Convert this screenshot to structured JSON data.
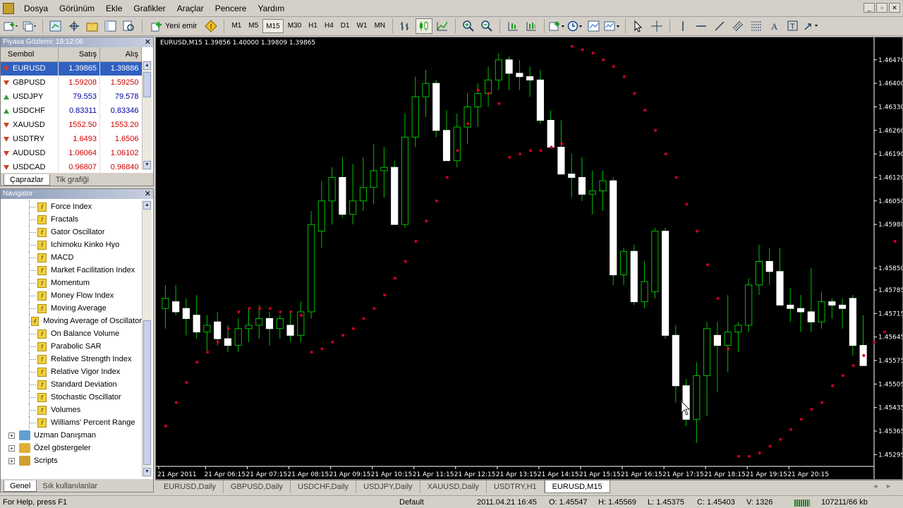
{
  "menu": [
    "Dosya",
    "Görünüm",
    "Ekle",
    "Grafikler",
    "Araçlar",
    "Pencere",
    "Yardım"
  ],
  "toolbar": {
    "new_order": "Yeni emir",
    "timeframes": [
      "M1",
      "M5",
      "M15",
      "M30",
      "H1",
      "H4",
      "D1",
      "W1",
      "MN"
    ],
    "active_timeframe": "M15"
  },
  "market_watch": {
    "title": "Piyasa Gözlemi: 18:12:06",
    "headers": {
      "symbol": "Sembol",
      "bid": "Satış",
      "ask": "Alış"
    },
    "rows": [
      {
        "symbol": "EURUSD",
        "bid": "1.39865",
        "ask": "1.39886",
        "dir": "down",
        "color": "blue",
        "selected": true
      },
      {
        "symbol": "GBPUSD",
        "bid": "1.59208",
        "ask": "1.59250",
        "dir": "down",
        "color": "red"
      },
      {
        "symbol": "USDJPY",
        "bid": "79.553",
        "ask": "79.578",
        "dir": "up",
        "color": "blue"
      },
      {
        "symbol": "USDCHF",
        "bid": "0.83311",
        "ask": "0.83346",
        "dir": "up",
        "color": "blue"
      },
      {
        "symbol": "XAUUSD",
        "bid": "1552.50",
        "ask": "1553.20",
        "dir": "down",
        "color": "red"
      },
      {
        "symbol": "USDTRY",
        "bid": "1.6493",
        "ask": "1.6506",
        "dir": "down",
        "color": "red"
      },
      {
        "symbol": "AUDUSD",
        "bid": "1.06064",
        "ask": "1.06102",
        "dir": "down",
        "color": "red"
      },
      {
        "symbol": "USDCAD",
        "bid": "0.96807",
        "ask": "0.96840",
        "dir": "down",
        "color": "red"
      }
    ],
    "tabs": [
      "Çaprazlar",
      "Tik grafiği"
    ]
  },
  "navigator": {
    "title": "Navigator",
    "indicators": [
      "Force Index",
      "Fractals",
      "Gator Oscillator",
      "Ichimoku Kinko Hyo",
      "MACD",
      "Market Facilitation Index",
      "Momentum",
      "Money Flow Index",
      "Moving Average",
      "Moving Average of Oscillator",
      "On Balance Volume",
      "Parabolic SAR",
      "Relative Strength Index",
      "Relative Vigor Index",
      "Standard Deviation",
      "Stochastic Oscillator",
      "Volumes",
      "Williams' Percent Range"
    ],
    "folders": [
      {
        "label": "Uzman Danışman",
        "icon": "expert-advisor-icon"
      },
      {
        "label": "Özel göstergeler",
        "icon": "custom-indicators-icon"
      },
      {
        "label": "Scripts",
        "icon": "scripts-icon"
      }
    ],
    "tabs": [
      "Genel",
      "Sık kullanılanlar"
    ]
  },
  "chart": {
    "header": "EURUSD,M15  1.39856 1.40000 1.39809 1.39865",
    "bull_color": "#00c000",
    "bear_color": "#ffffff",
    "sar_color": "#d00020"
  },
  "chart_data": {
    "type": "candlestick",
    "symbol": "EURUSD",
    "timeframe": "M15",
    "ylim": [
      1.4526,
      1.4652
    ],
    "y_ticks": [
      "1.46470",
      "1.46400",
      "1.46330",
      "1.46260",
      "1.46190",
      "1.46120",
      "1.46050",
      "1.45980",
      "1.45850",
      "1.45785",
      "1.45715",
      "1.45645",
      "1.45575",
      "1.45505",
      "1.45435",
      "1.45365",
      "1.45295"
    ],
    "x_ticks": [
      "21 Apr 2011",
      "21 Apr 06:15",
      "21 Apr 07:15",
      "21 Apr 08:15",
      "21 Apr 09:15",
      "21 Apr 10:15",
      "21 Apr 11:15",
      "21 Apr 12:15",
      "21 Apr 13:15",
      "21 Apr 14:15",
      "21 Apr 15:15",
      "21 Apr 16:15",
      "21 Apr 17:15",
      "21 Apr 18:15",
      "21 Apr 19:15",
      "21 Apr 20:15"
    ],
    "candles": [
      [
        1.4573,
        1.458,
        1.4567,
        1.4576
      ],
      [
        1.4575,
        1.458,
        1.4571,
        1.4572
      ],
      [
        1.4573,
        1.4576,
        1.4565,
        1.457
      ],
      [
        1.4571,
        1.4577,
        1.4564,
        1.4566
      ],
      [
        1.4566,
        1.4571,
        1.456,
        1.4568
      ],
      [
        1.4569,
        1.4572,
        1.4562,
        1.4564
      ],
      [
        1.4564,
        1.4568,
        1.456,
        1.4562
      ],
      [
        1.4562,
        1.457,
        1.456,
        1.4567
      ],
      [
        1.4567,
        1.4573,
        1.4563,
        1.4568
      ],
      [
        1.4568,
        1.4574,
        1.4564,
        1.457
      ],
      [
        1.457,
        1.4572,
        1.4562,
        1.4567
      ],
      [
        1.4567,
        1.4571,
        1.4564,
        1.457
      ],
      [
        1.4568,
        1.4572,
        1.4563,
        1.4565
      ],
      [
        1.4565,
        1.4575,
        1.4563,
        1.4572
      ],
      [
        1.4572,
        1.4602,
        1.457,
        1.4598
      ],
      [
        1.4596,
        1.4611,
        1.4591,
        1.4605
      ],
      [
        1.4605,
        1.4615,
        1.4598,
        1.4612
      ],
      [
        1.4612,
        1.4618,
        1.46,
        1.4601
      ],
      [
        1.4601,
        1.4616,
        1.4598,
        1.4605
      ],
      [
        1.4605,
        1.4618,
        1.4602,
        1.4609
      ],
      [
        1.4609,
        1.4622,
        1.4604,
        1.4614
      ],
      [
        1.4614,
        1.4621,
        1.4606,
        1.4615
      ],
      [
        1.4615,
        1.4617,
        1.46,
        1.4598
      ],
      [
        1.4598,
        1.4631,
        1.4597,
        1.4624
      ],
      [
        1.4624,
        1.4642,
        1.4621,
        1.4636
      ],
      [
        1.4636,
        1.4644,
        1.463,
        1.464
      ],
      [
        1.464,
        1.4641,
        1.4624,
        1.4626
      ],
      [
        1.4626,
        1.4632,
        1.4617,
        1.4617
      ],
      [
        1.4617,
        1.4631,
        1.4615,
        1.4627
      ],
      [
        1.4627,
        1.4637,
        1.4622,
        1.4633
      ],
      [
        1.4633,
        1.464,
        1.4627,
        1.4637
      ],
      [
        1.4637,
        1.4645,
        1.4633,
        1.4641
      ],
      [
        1.4641,
        1.4649,
        1.4638,
        1.4647
      ],
      [
        1.4647,
        1.4648,
        1.4638,
        1.4643
      ],
      [
        1.4643,
        1.4647,
        1.4638,
        1.4642
      ],
      [
        1.4642,
        1.4645,
        1.4636,
        1.4641
      ],
      [
        1.4641,
        1.4644,
        1.4628,
        1.4629
      ],
      [
        1.4629,
        1.4632,
        1.4621,
        1.4621
      ],
      [
        1.4621,
        1.4629,
        1.4613,
        1.4613
      ],
      [
        1.4613,
        1.4619,
        1.4606,
        1.4612
      ],
      [
        1.4612,
        1.4618,
        1.4605,
        1.4607
      ],
      [
        1.4607,
        1.4614,
        1.4601,
        1.4608
      ],
      [
        1.4608,
        1.4614,
        1.4602,
        1.4611
      ],
      [
        1.4611,
        1.4612,
        1.458,
        1.4583
      ],
      [
        1.4583,
        1.4591,
        1.458,
        1.459
      ],
      [
        1.459,
        1.4592,
        1.4574,
        1.4575
      ],
      [
        1.4575,
        1.4587,
        1.4573,
        1.4581
      ],
      [
        1.4578,
        1.4597,
        1.4576,
        1.4596
      ],
      [
        1.4596,
        1.4597,
        1.4564,
        1.4565
      ],
      [
        1.4565,
        1.4568,
        1.4545,
        1.455
      ],
      [
        1.455,
        1.4552,
        1.4538,
        1.454
      ],
      [
        1.454,
        1.4557,
        1.4533,
        1.4553
      ],
      [
        1.4553,
        1.4569,
        1.4541,
        1.4567
      ],
      [
        1.4565,
        1.4569,
        1.4548,
        1.4562
      ],
      [
        1.4562,
        1.4577,
        1.4554,
        1.4566
      ],
      [
        1.4566,
        1.4569,
        1.456,
        1.4568
      ],
      [
        1.4568,
        1.4582,
        1.4566,
        1.458
      ],
      [
        1.458,
        1.4592,
        1.4577,
        1.4587
      ],
      [
        1.4587,
        1.4591,
        1.458,
        1.4584
      ],
      [
        1.4584,
        1.4591,
        1.4574,
        1.4574
      ],
      [
        1.4574,
        1.4579,
        1.4569,
        1.4573
      ],
      [
        1.4573,
        1.4577,
        1.4566,
        1.4572
      ],
      [
        1.4572,
        1.4585,
        1.4566,
        1.4569
      ],
      [
        1.4569,
        1.4578,
        1.4567,
        1.4575
      ],
      [
        1.4575,
        1.4576,
        1.457,
        1.4574
      ],
      [
        1.4574,
        1.4576,
        1.4567,
        1.4573
      ],
      [
        1.4576,
        1.4577,
        1.4559,
        1.4562
      ],
      [
        1.4562,
        1.4571,
        1.4556,
        1.4556
      ]
    ],
    "sar": [
      1.4538,
      1.4545,
      1.4551,
      1.4557,
      1.456,
      1.4563,
      1.4567,
      1.4572,
      1.4573,
      1.4573,
      1.4573,
      1.4572,
      1.4572,
      1.4571,
      1.456,
      1.4561,
      1.4563,
      1.4565,
      1.4567,
      1.457,
      1.4573,
      1.4577,
      1.4582,
      1.4587,
      1.4593,
      1.4599,
      1.4605,
      1.4612,
      1.462,
      1.4628,
      1.4638,
      1.4637,
      1.4634,
      1.4618,
      1.4619,
      1.462,
      1.462,
      1.4621,
      1.4622,
      1.4651,
      1.465,
      1.4649,
      1.4647,
      1.4645,
      1.4642,
      1.4637,
      1.4632,
      1.4626,
      1.4619,
      1.4612,
      1.4604,
      1.4596,
      1.4586,
      1.4576,
      1.4561,
      1.4529,
      1.4529,
      1.453,
      1.4532,
      1.4534,
      1.4537,
      1.454,
      1.4543,
      1.4545,
      1.455,
      1.4553,
      1.4556,
      1.4559,
      1.4563,
      1.4566,
      1.4593,
      1.4592
    ]
  },
  "chart_tabs": [
    "EURUSD,Daily",
    "GBPUSD,Daily",
    "USDCHF,Daily",
    "USDJPY,Daily",
    "XAUUSD,Daily",
    "USDTRY,H1",
    "EURUSD,M15"
  ],
  "active_chart_tab": "EURUSD,M15",
  "status": {
    "help": "For Help, press F1",
    "profile": "Default",
    "datetime": "2011.04.21 16:45",
    "open": "O: 1.45547",
    "high": "H: 1.45569",
    "low": "L: 1.45375",
    "close": "C: 1.45403",
    "volume": "V: 1326",
    "traffic": "107211/66 kb"
  }
}
